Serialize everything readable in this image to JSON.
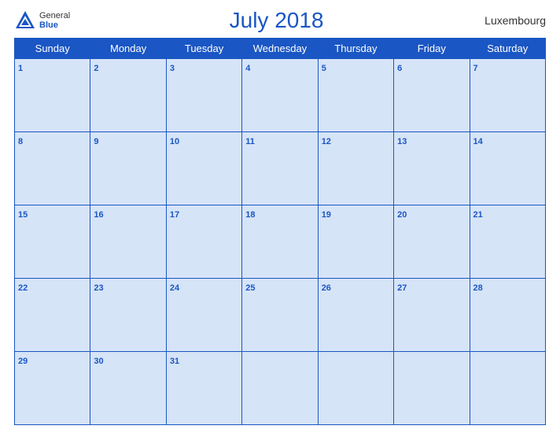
{
  "header": {
    "title": "July 2018",
    "country": "Luxembourg",
    "logo_general": "General",
    "logo_blue": "Blue"
  },
  "weekdays": [
    "Sunday",
    "Monday",
    "Tuesday",
    "Wednesday",
    "Thursday",
    "Friday",
    "Saturday"
  ],
  "weeks": [
    [
      1,
      2,
      3,
      4,
      5,
      6,
      7
    ],
    [
      8,
      9,
      10,
      11,
      12,
      13,
      14
    ],
    [
      15,
      16,
      17,
      18,
      19,
      20,
      21
    ],
    [
      22,
      23,
      24,
      25,
      26,
      27,
      28
    ],
    [
      29,
      30,
      31,
      null,
      null,
      null,
      null
    ]
  ]
}
